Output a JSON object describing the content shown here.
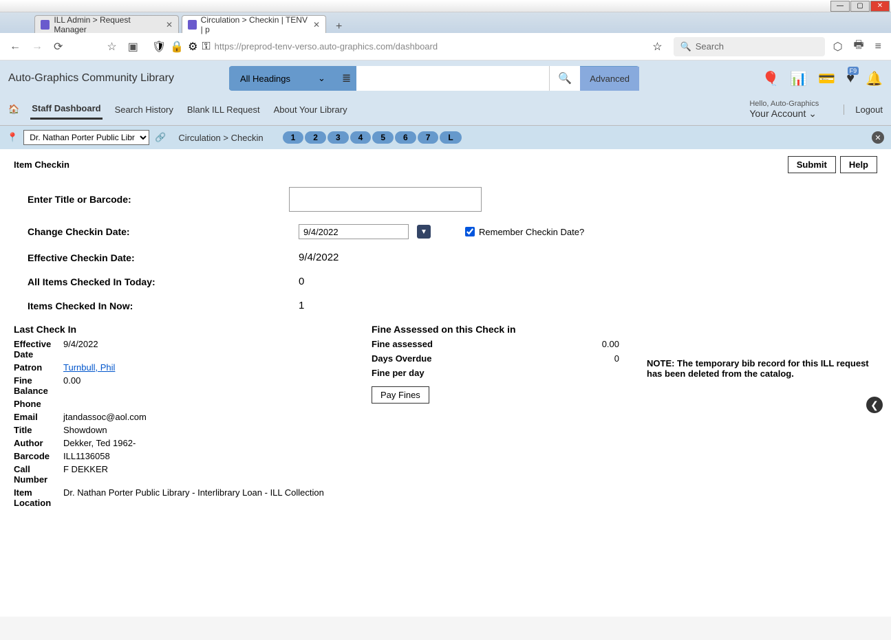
{
  "window": {
    "tabs": [
      {
        "title": "ILL Admin > Request Manager"
      },
      {
        "title": "Circulation > Checkin | TENV | p"
      }
    ]
  },
  "browser": {
    "url": "https://preprod-tenv-verso.auto-graphics.com/dashboard",
    "search_placeholder": "Search"
  },
  "header": {
    "library_name": "Auto-Graphics Community Library",
    "search_scope": "All Headings",
    "advanced_label": "Advanced",
    "fkey_badge": "F9",
    "hello": "Hello, Auto-Graphics",
    "account_label": "Your Account",
    "logout": "Logout"
  },
  "nav": {
    "items": [
      "Staff Dashboard",
      "Search History",
      "Blank ILL Request",
      "About Your Library"
    ],
    "active_index": 0
  },
  "subbar": {
    "location": "Dr. Nathan Porter Public Libr",
    "breadcrumb_parts": [
      "Circulation",
      "Checkin"
    ],
    "pills": [
      "1",
      "2",
      "3",
      "4",
      "5",
      "6",
      "7",
      "L"
    ]
  },
  "page": {
    "title": "Item Checkin",
    "submit": "Submit",
    "help": "Help",
    "labels": {
      "enter_barcode": "Enter Title or Barcode:",
      "change_date": "Change Checkin Date:",
      "remember": "Remember Checkin Date?",
      "effective_date": "Effective Checkin Date:",
      "all_today": "All Items Checked In Today:",
      "now": "Items Checked In Now:"
    },
    "values": {
      "barcode": "",
      "checkin_date": "9/4/2022",
      "remember_checked": true,
      "effective_date": "9/4/2022",
      "all_today": "0",
      "now": "1"
    }
  },
  "last_checkin": {
    "header": "Last Check In",
    "fields": {
      "effective_date_label": "Effective Date",
      "effective_date": "9/4/2022",
      "patron_label": "Patron",
      "patron": "Turnbull, Phil",
      "fine_balance_label": "Fine Balance",
      "fine_balance": "0.00",
      "phone_label": "Phone",
      "phone": "",
      "email_label": "Email",
      "email": "jtandassoc@aol.com",
      "title_label": "Title",
      "title": "Showdown",
      "author_label": "Author",
      "author": "Dekker, Ted 1962-",
      "barcode_label": "Barcode",
      "barcode": "ILL1136058",
      "call_label": "Call Number",
      "call": "F DEKKER",
      "loc_label": "Item Location",
      "loc": "Dr. Nathan Porter Public Library - Interlibrary Loan - ILL Collection"
    }
  },
  "fines": {
    "header": "Fine Assessed on this Check in",
    "assessed_label": "Fine assessed",
    "assessed": "0.00",
    "overdue_label": "Days Overdue",
    "overdue": "0",
    "perday_label": "Fine per day",
    "perday": "",
    "pay_label": "Pay Fines"
  },
  "note": "NOTE: The temporary bib record for this ILL request has been deleted from the catalog."
}
